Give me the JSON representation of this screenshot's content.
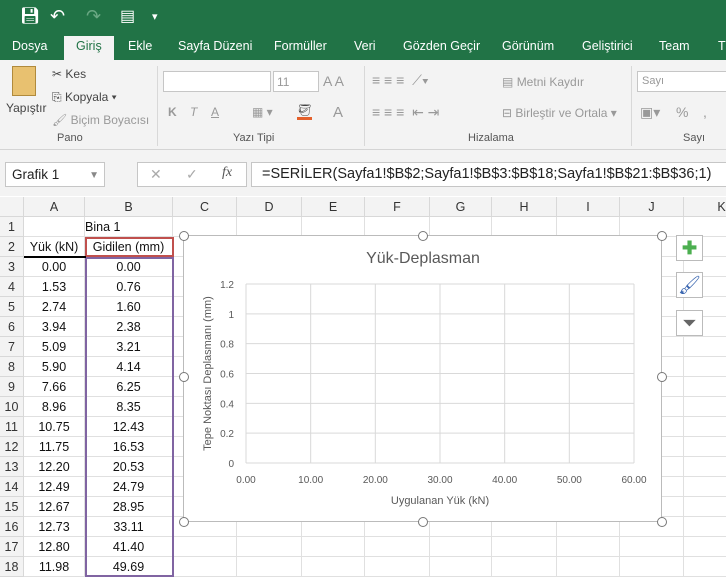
{
  "quick_access": {
    "save": "save-icon",
    "undo": "undo-icon",
    "redo": "redo-icon",
    "touch": "touch-mode-icon",
    "customize": "customize-icon"
  },
  "tabs": [
    "Dosya",
    "Giriş",
    "Ekle",
    "Sayfa Düzeni",
    "Formüller",
    "Veri",
    "Gözden Geçir",
    "Görünüm",
    "Geliştirici",
    "Team",
    "T"
  ],
  "active_tab": "Giriş",
  "ribbon": {
    "paste": "Yapıştır",
    "cut": "Kes",
    "copy": "Kopyala",
    "format_painter": "Biçim Boyacısı",
    "group_clipboard": "Pano",
    "font_name": "",
    "font_size": "11",
    "bold": "K",
    "italic": "T",
    "underline": "A",
    "font_color": "A",
    "group_font": "Yazı Tipi",
    "wrap_text": "Metni Kaydır",
    "merge_center": "Birleştir ve Ortala",
    "group_alignment": "Hizalama",
    "number_format": "Sayı",
    "percent": "%",
    "comma": ",",
    "group_number": "Sayı"
  },
  "formula_bar": {
    "name_box": "Grafik 1",
    "cancel": "✕",
    "enter": "✓",
    "fx": "fx",
    "formula": "=SERİLER(Sayfa1!$B$2;Sayfa1!$B$3:$B$18;Sayfa1!$B$21:$B$36;1)"
  },
  "columns": [
    "A",
    "B",
    "C",
    "D",
    "E",
    "F",
    "G",
    "H",
    "I",
    "J",
    "K"
  ],
  "rows": [
    "1",
    "2",
    "3",
    "4",
    "5",
    "6",
    "7",
    "8",
    "9",
    "10",
    "11",
    "12",
    "13",
    "14",
    "15",
    "16",
    "17",
    "18"
  ],
  "cells": {
    "B1": "Bina 1",
    "A2": "Yük (kN)",
    "B2": "Gidilen (mm)",
    "A": [
      "0.00",
      "1.53",
      "2.74",
      "3.94",
      "5.09",
      "5.90",
      "7.66",
      "8.96",
      "10.75",
      "11.75",
      "12.20",
      "12.49",
      "12.67",
      "12.73",
      "12.80",
      "11.98"
    ],
    "B": [
      "0.00",
      "0.76",
      "1.60",
      "2.38",
      "3.21",
      "4.14",
      "6.25",
      "8.35",
      "12.43",
      "16.53",
      "20.53",
      "24.79",
      "28.95",
      "33.11",
      "41.40",
      "49.69"
    ]
  },
  "chart_data": {
    "type": "scatter",
    "title": "Yük-Deplasman",
    "xlabel": "Uygulanan Yük (kN)",
    "ylabel": "Tepe Noktası Deplasmanı (mm)",
    "xlim": [
      0,
      60
    ],
    "ylim": [
      0,
      1.2
    ],
    "xticks": [
      "0.00",
      "10.00",
      "20.00",
      "30.00",
      "40.00",
      "50.00",
      "60.00"
    ],
    "yticks": [
      "0",
      "0.2",
      "0.4",
      "0.6",
      "0.8",
      "1",
      "1.2"
    ],
    "grid": true,
    "series": []
  },
  "chart_buttons": [
    "plus-icon",
    "brush-icon",
    "filter-icon"
  ]
}
